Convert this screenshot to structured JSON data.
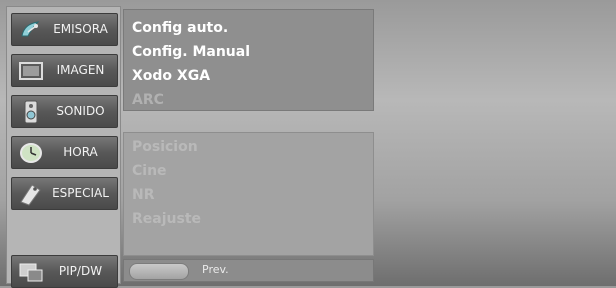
{
  "menu": {
    "categories": [
      {
        "label": "EMISORA",
        "icon": "satellite-dish-icon"
      },
      {
        "label": "IMAGEN",
        "icon": "tv-screen-icon"
      },
      {
        "label": "SONIDO",
        "icon": "speaker-icon"
      },
      {
        "label": "HORA",
        "icon": "clock-icon"
      },
      {
        "label": "ESPECIAL",
        "icon": "tag-icon"
      },
      {
        "label": "PIP/DW",
        "icon": "pip-windows-icon"
      }
    ],
    "options": [
      "Config auto.",
      "Config. Manual",
      "Xodo XGA",
      "ARC"
    ],
    "options_disabled": [
      "Posicion",
      "Cine",
      "NR",
      "Reajuste"
    ],
    "prev_label": "Prev."
  }
}
